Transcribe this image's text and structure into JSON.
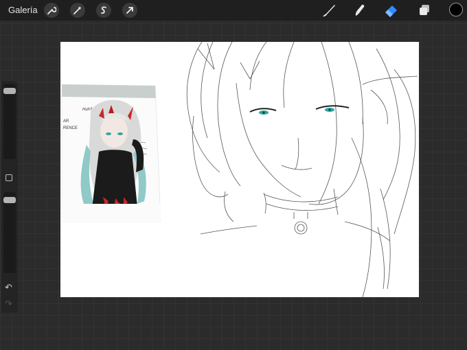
{
  "topbar": {
    "gallery_label": "Galería",
    "actions": [
      "wrench-icon",
      "magic-wand-icon",
      "selection-icon",
      "transform-arrow-icon"
    ],
    "tools": [
      "brush-icon",
      "smudge-icon",
      "eraser-icon",
      "layers-icon"
    ],
    "active_tool": "eraser",
    "accent_color": "#2f8cff",
    "current_color": "#000000"
  },
  "sidebar": {
    "brush_size_level": 0.06,
    "opacity_level": 0.06,
    "modify_icon": "square-icon",
    "undo_icon": "undo-arrow-icon",
    "redo_icon": "redo-arrow-icon"
  },
  "reference": {
    "sketch_texts": [
      "AR",
      "RENCE",
      "Huh?"
    ]
  }
}
